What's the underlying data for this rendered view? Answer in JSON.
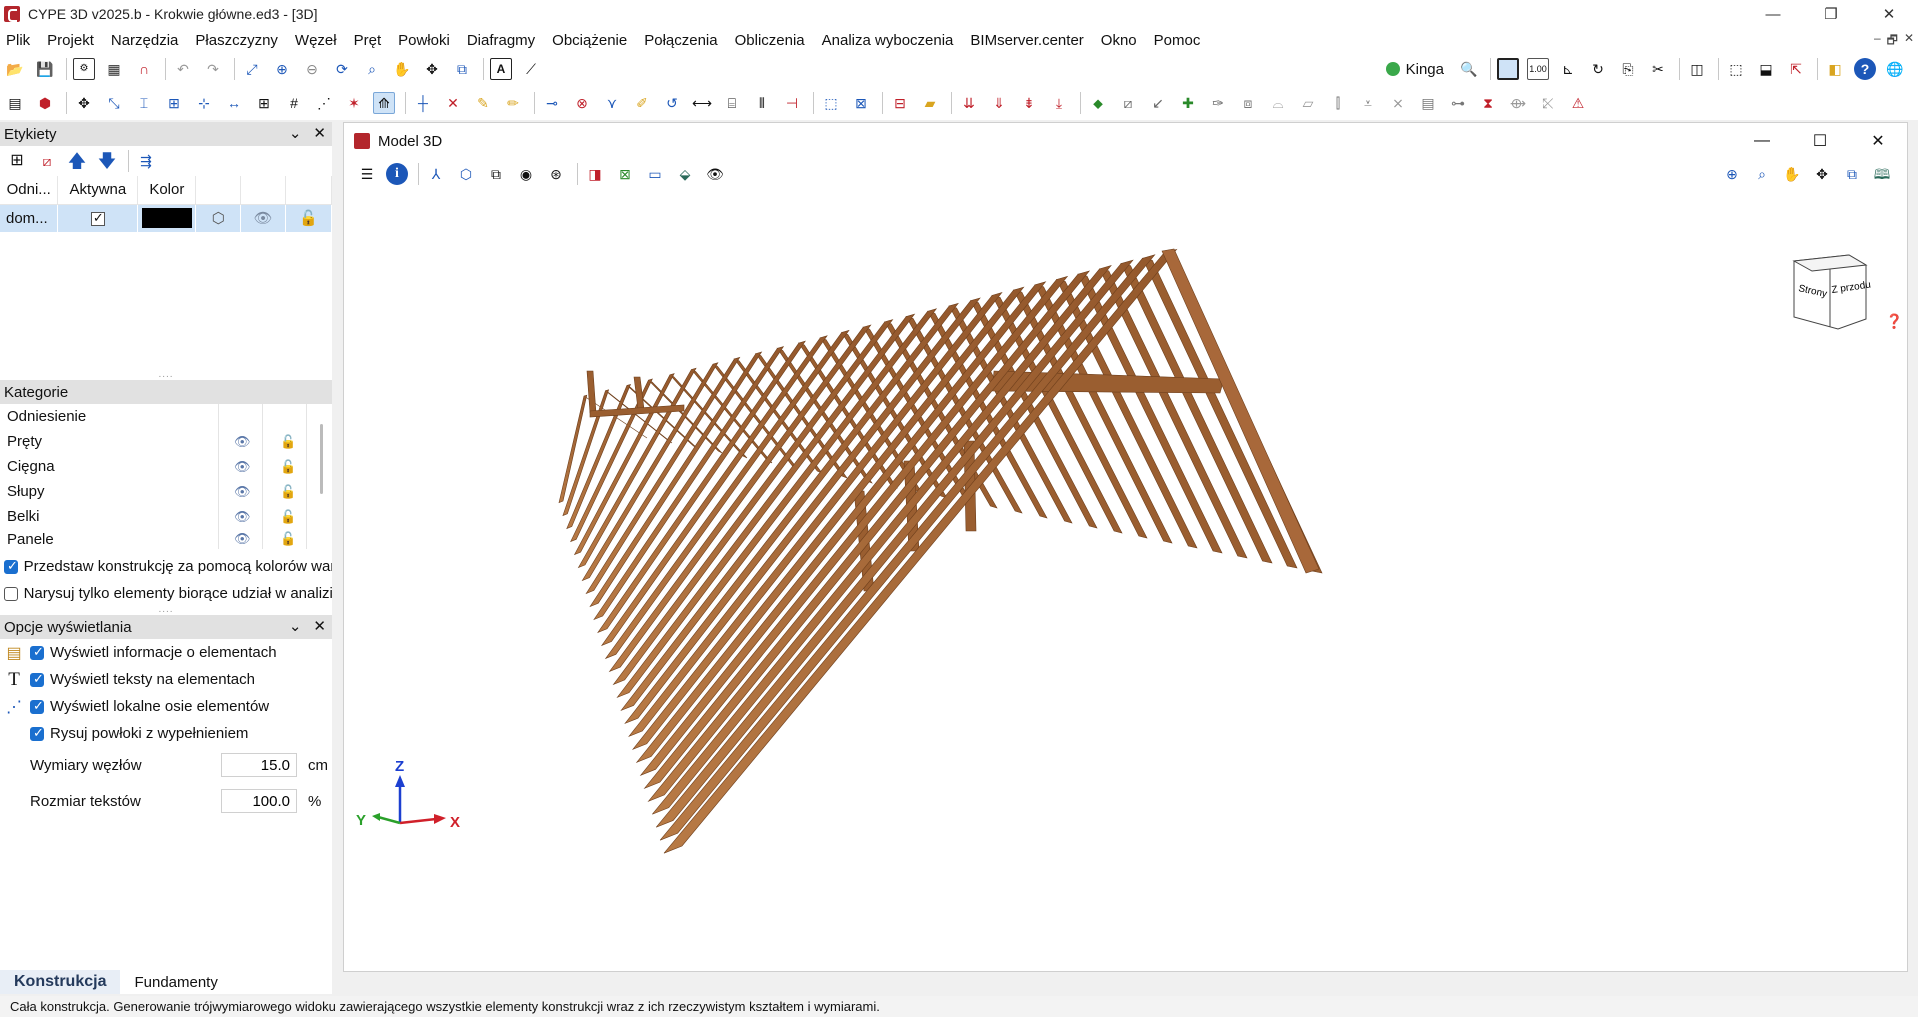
{
  "window": {
    "title": "CYPE 3D v2025.b - Krokwie główne.ed3 - [3D]",
    "controls": [
      "—",
      "❐",
      "✕"
    ]
  },
  "menu": [
    "Plik",
    "Projekt",
    "Narzędzia",
    "Płaszczyzny",
    "Węzeł",
    "Pręt",
    "Powłoki",
    "Diafragmy",
    "Obciążenie",
    "Połączenia",
    "Obliczenia",
    "Analiza wyboczenia",
    "BIMserver.center",
    "Okno",
    "Pomoc"
  ],
  "mdi_controls": [
    "–",
    "🗗",
    "✕"
  ],
  "user": {
    "name": "Kinga"
  },
  "toolbar_icons": {
    "row1": [
      "folder-open-icon",
      "save-icon",
      "settings-icon",
      "grid-icon",
      "magnet-icon",
      "undo-icon",
      "redo-icon",
      "zoom-window-icon",
      "zoom-all-icon",
      "zoom-out-icon",
      "rotate-icon",
      "zoom-region-icon",
      "pan-icon",
      "orbit-icon",
      "view-icon",
      "image-icon",
      "axis-icon"
    ],
    "row1_right": [
      "search-icon",
      "frame-icon",
      "measure-icon",
      "floor-icon",
      "refresh-icon",
      "copy-icon",
      "scissors-icon",
      "layout-icon",
      "box-icon",
      "box-light-icon",
      "export-icon",
      "bim-icon",
      "help-icon",
      "globe-icon"
    ],
    "row2_count": 62
  },
  "labels_panel": {
    "title": "Etykiety",
    "columns": [
      "Odni...",
      "Aktywna",
      "Kolor",
      "",
      "",
      ""
    ],
    "row": {
      "name": "dom...",
      "active": true,
      "color": "#000000"
    }
  },
  "categories_panel": {
    "title": "Kategorie",
    "header": "Odniesienie",
    "items": [
      "Pręty",
      "Cięgna",
      "Słupy",
      "Belki",
      "Panele"
    ]
  },
  "checks": [
    {
      "label": "Przedstaw konstrukcję za pomocą kolorów war",
      "checked": true
    },
    {
      "label": "Narysuj tylko elementy biorące udział w analizi",
      "checked": false
    }
  ],
  "display_options": {
    "title": "Opcje wyświetlania",
    "items": [
      {
        "label": "Wyświetl informacje o elementach",
        "icon": "info-table-icon",
        "checked": true
      },
      {
        "label": "Wyświetl teksty na elementach",
        "icon": "text-icon",
        "checked": true
      },
      {
        "label": "Wyświetl lokalne osie elementów",
        "icon": "local-axes-icon",
        "checked": true
      },
      {
        "label": "Rysuj powłoki z wypełnieniem",
        "icon": "",
        "checked": true
      }
    ],
    "node_size": {
      "label": "Wymiary węzłów",
      "value": "15.0",
      "unit": "cm"
    },
    "text_size": {
      "label": "Rozmiar tekstów",
      "value": "100.0",
      "unit": "%"
    }
  },
  "bottom_tabs": [
    {
      "label": "Konstrukcja",
      "active": true
    },
    {
      "label": "Fundamenty",
      "active": false
    }
  ],
  "status": "Cała konstrukcja. Generowanie trójwymiarowego widoku zawierającego wszystkie elementy konstrukcji wraz z ich rzeczywistym kształtem i wymiarami.",
  "model_window": {
    "title": "Model 3D",
    "view_cube": {
      "top": "Strony",
      "front": "Z przodu"
    },
    "axes": {
      "x": "X",
      "y": "Y",
      "z": "Z"
    },
    "wood_color": "#a8683a",
    "rafter_count": 28
  }
}
